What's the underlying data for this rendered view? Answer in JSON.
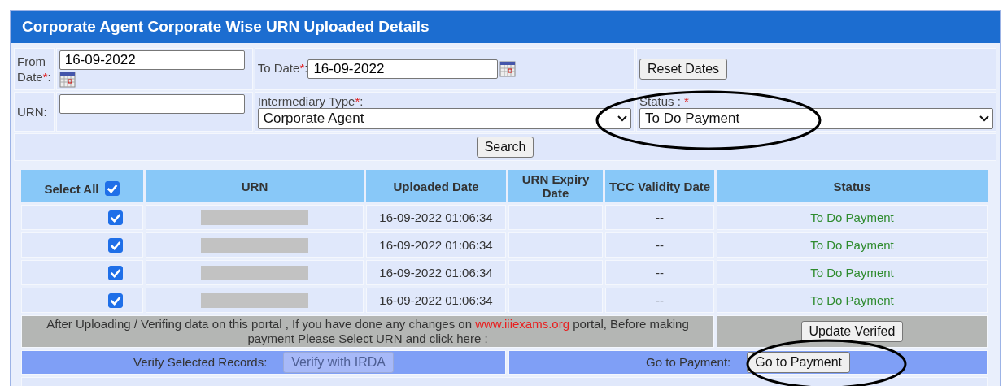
{
  "title": "Corporate Agent Corporate Wise URN Uploaded Details",
  "filters": {
    "from_date": {
      "label": "From Date",
      "required_mark": "*",
      "colon": ":",
      "value": "16-09-2022"
    },
    "to_date": {
      "label": "To Date",
      "required_mark": "*",
      "colon": ":",
      "value": "16-09-2022"
    },
    "reset_button": "Reset Dates",
    "urn": {
      "label": "URN:"
    },
    "intermediary_type": {
      "label": "Intermediary Type",
      "required_mark": "*",
      "colon": ":",
      "value": "Corporate Agent"
    },
    "status": {
      "label": "Status :",
      "required_mark": "*",
      "value": "To Do Payment",
      "highlighted": true
    },
    "search_button": "Search"
  },
  "table": {
    "select_all": {
      "label": "Select All",
      "checked": true
    },
    "columns": [
      "URN",
      "Uploaded Date",
      "URN Expiry Date",
      "TCC Validity Date",
      "Status"
    ],
    "rows": [
      {
        "checked": true,
        "urn_redacted": true,
        "uploaded": "16-09-2022 01:06:34",
        "expiry": "",
        "tcc": "--",
        "status": "To Do Payment"
      },
      {
        "checked": true,
        "urn_redacted": true,
        "uploaded": "16-09-2022 01:06:34",
        "expiry": "",
        "tcc": "--",
        "status": "To Do Payment"
      },
      {
        "checked": true,
        "urn_redacted": true,
        "uploaded": "16-09-2022 01:06:34",
        "expiry": "",
        "tcc": "--",
        "status": "To Do Payment"
      },
      {
        "checked": true,
        "urn_redacted": true,
        "uploaded": "16-09-2022 01:06:34",
        "expiry": "",
        "tcc": "--",
        "status": "To Do Payment"
      }
    ]
  },
  "notice": {
    "before": "After Uploading / Verifing data on this portal , If you have done any changes on",
    "link": "www.iiiexams.org",
    "after": "portal, Before making payment Please Select URN and click here :"
  },
  "update_button": "Update Verifed",
  "verify": {
    "label": "Verify Selected Records:",
    "button": "Verify with IRDA",
    "disabled": true
  },
  "payment": {
    "label": "Go to Payment:",
    "button": "Go to Payment",
    "highlighted": true
  }
}
